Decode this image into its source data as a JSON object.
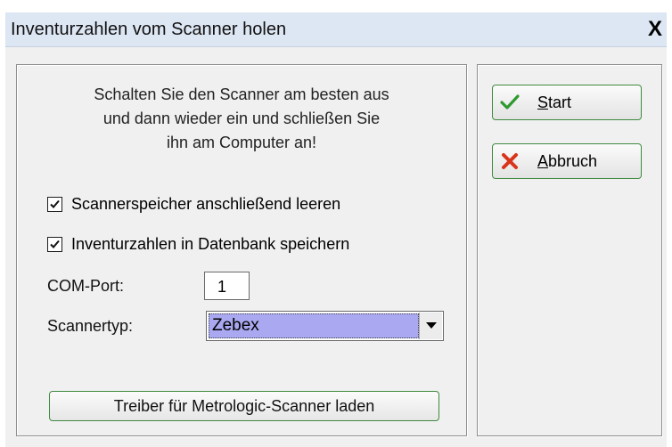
{
  "window": {
    "title": "Inventurzahlen vom Scanner holen",
    "close_label": "X"
  },
  "message": {
    "line1": "Schalten Sie den Scanner am besten aus",
    "line2": "und dann wieder ein und schließen Sie",
    "line3": "ihn am Computer an!"
  },
  "options": {
    "clear_memory": {
      "label": "Scannerspeicher anschließend leeren",
      "checked": true
    },
    "save_db": {
      "label": "Inventurzahlen in Datenbank speichern",
      "checked": true
    }
  },
  "com_port": {
    "label": "COM-Port:",
    "value": "1"
  },
  "scanner_type": {
    "label": "Scannertyp:",
    "value": "Zebex"
  },
  "driver_button": {
    "label": "Treiber für Metrologic-Scanner laden"
  },
  "start_button": {
    "accel": "S",
    "rest": "tart",
    "icon": "checkmark-icon"
  },
  "cancel_button": {
    "accel": "A",
    "rest": "bbruch",
    "icon": "cross-icon"
  },
  "colors": {
    "title_bar": "#dde6f3",
    "dialog_bg": "#f0f0f0",
    "button_border": "#3f8a3f",
    "select_highlight": "#a9a8f0",
    "check_green": "#2f9a2f",
    "cancel_red": "#d9341c"
  }
}
